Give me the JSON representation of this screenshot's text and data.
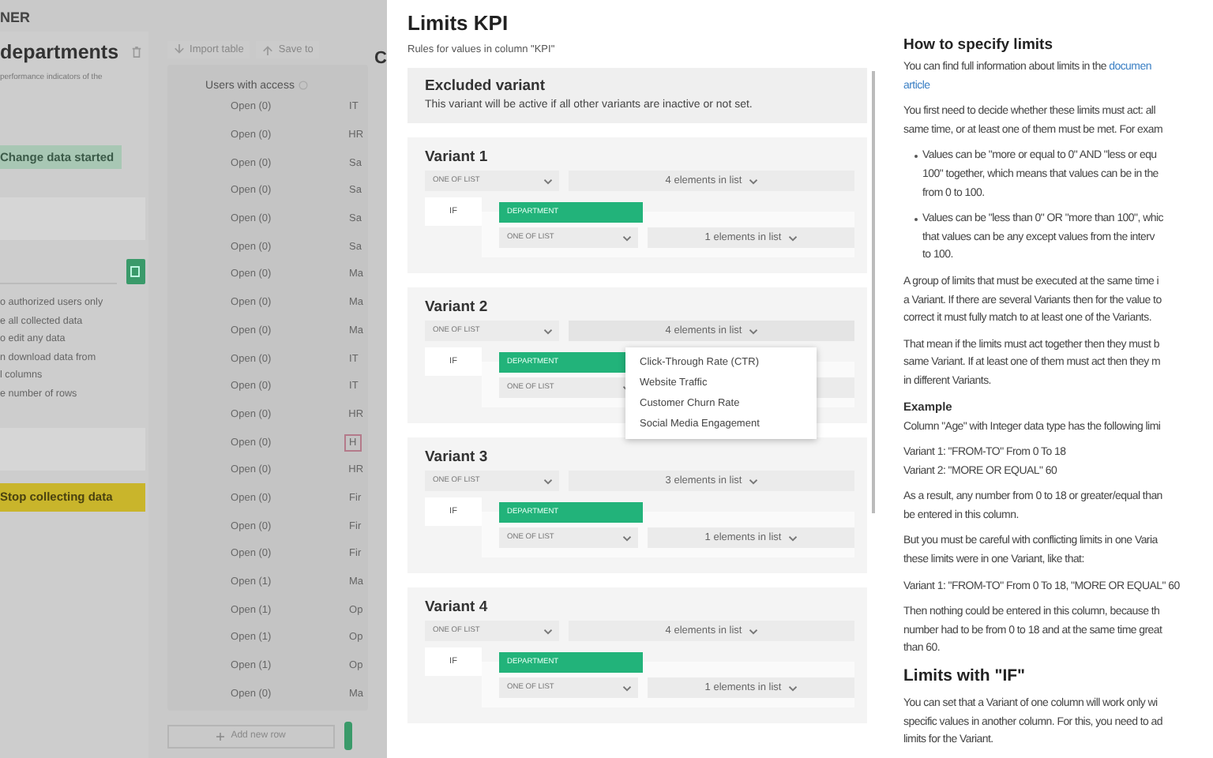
{
  "background_app": {
    "header": "NER",
    "panel": {
      "title": "departments",
      "description": "performance indicators of the",
      "status_badge": "Change data started",
      "options": [
        "o authorized users only",
        "e all collected data",
        "o edit any data",
        "n download data from",
        "l columns",
        "e number of rows"
      ],
      "stop_button": "Stop collecting data"
    },
    "toolbar": [
      "Import table",
      "Save to"
    ],
    "table": {
      "column": "Users with access",
      "rows": [
        {
          "access": "Open (0)",
          "column_2": "IT",
          "highlighted": false
        },
        {
          "access": "Open (0)",
          "column_2": "HR",
          "highlighted": false
        },
        {
          "access": "Open (0)",
          "column_2": "Sa",
          "highlighted": false
        },
        {
          "access": "Open (0)",
          "column_2": "Sa",
          "highlighted": false
        },
        {
          "access": "Open (0)",
          "column_2": "Sa",
          "highlighted": false
        },
        {
          "access": "Open (0)",
          "column_2": "Sa",
          "highlighted": false
        },
        {
          "access": "Open (0)",
          "column_2": "Ma",
          "highlighted": false
        },
        {
          "access": "Open (0)",
          "column_2": "Ma",
          "highlighted": false
        },
        {
          "access": "Open (0)",
          "column_2": "Ma",
          "highlighted": false
        },
        {
          "access": "Open (0)",
          "column_2": "IT",
          "highlighted": false
        },
        {
          "access": "Open (0)",
          "column_2": "IT",
          "highlighted": false
        },
        {
          "access": "Open (0)",
          "column_2": "HR",
          "highlighted": false
        },
        {
          "access": "Open (0)",
          "column_2": "H",
          "highlighted": true
        },
        {
          "access": "Open (0)",
          "column_2": "HR",
          "highlighted": false
        },
        {
          "access": "Open (0)",
          "column_2": "Fir",
          "highlighted": false
        },
        {
          "access": "Open (0)",
          "column_2": "Fir",
          "highlighted": false
        },
        {
          "access": "Open (0)",
          "column_2": "Fir",
          "highlighted": false
        },
        {
          "access": "Open (1)",
          "column_2": "Ma",
          "highlighted": false
        },
        {
          "access": "Open (1)",
          "column_2": "Op",
          "highlighted": false
        },
        {
          "access": "Open (1)",
          "column_2": "Op",
          "highlighted": false
        },
        {
          "access": "Open (1)",
          "column_2": "Op",
          "highlighted": false
        },
        {
          "access": "Open (0)",
          "column_2": "Ma",
          "highlighted": false
        }
      ]
    },
    "add_row_button": "Add new row",
    "next_panel_title": "C"
  },
  "limits": {
    "title": "Limits KPI",
    "subtitle": "Rules for values in column \"KPI\"",
    "excluded": {
      "title": "Excluded variant",
      "text": "This variant will be active if all other variants are inactive or not set."
    },
    "variants": [
      {
        "title": "Variant 1",
        "operator": "ONE OF LIST",
        "values": "4 elements in list",
        "condition": {
          "label": "IF",
          "column": "DEPARTMENT",
          "operator": "ONE OF LIST",
          "values": "1 elements in list"
        }
      },
      {
        "title": "Variant 2",
        "operator": "ONE OF LIST",
        "values": "4 elements in list",
        "options": [
          "Click-Through Rate (CTR)",
          "Website Traffic",
          "Customer Churn Rate",
          "Social Media Engagement"
        ],
        "condition": {
          "label": "IF",
          "column": "DEPARTMENT",
          "operator": "ONE OF LIST"
        }
      },
      {
        "title": "Variant 3",
        "operator": "ONE OF LIST",
        "values": "3 elements in list",
        "condition": {
          "label": "IF",
          "column": "DEPARTMENT",
          "operator": "ONE OF LIST",
          "values": "1 elements in list"
        }
      },
      {
        "title": "Variant 4",
        "operator": "ONE OF LIST",
        "values": "4 elements in list",
        "condition": {
          "label": "IF",
          "column": "DEPARTMENT",
          "operator": "ONE OF LIST",
          "values": "1 elements in list"
        }
      }
    ]
  },
  "help": [
    {
      "kind": "heading",
      "text": "How to specify limits"
    },
    {
      "kind": "paragraph",
      "lines": [
        {
          "text": "You can find full information about limits in the ",
          "link": "documen"
        },
        {
          "link": "article"
        }
      ]
    },
    {
      "kind": "paragraph",
      "lines": [
        {
          "text": "You first need to decide whether these limits must act: all"
        },
        {
          "text": "same time, or at least one of them must be met. For exam"
        }
      ]
    },
    {
      "kind": "bullet",
      "lines": [
        {
          "text": "Values can be \"more or equal to 0\" AND \"less or equ"
        },
        {
          "text": "100\" together, which means that values can be in the"
        },
        {
          "text": "from 0 to 100."
        }
      ]
    },
    {
      "kind": "bullet",
      "lines": [
        {
          "text": "Values can be \"less than 0\" OR \"more than 100\", whic"
        },
        {
          "text": "that values can be any except values from the interv"
        },
        {
          "text": "to 100."
        }
      ]
    },
    {
      "kind": "paragraph",
      "lines": [
        {
          "text": "A group of limits that must be executed at the same time i"
        },
        {
          "text": "a Variant. If there are several Variants then for the value to"
        },
        {
          "text": "correct it must fully match to at least one of the Variants."
        }
      ]
    },
    {
      "kind": "paragraph",
      "lines": [
        {
          "text": "That mean if the limits must act together then they must b"
        },
        {
          "text": "same Variant. If at least one of them must act then they m"
        },
        {
          "text": "in different Variants."
        }
      ]
    },
    {
      "kind": "subheading",
      "text": "Example"
    },
    {
      "kind": "paragraph",
      "lines": [
        {
          "text": "Column \"Age\" with Integer data type has the following limi"
        }
      ]
    },
    {
      "kind": "paragraph",
      "lines": [
        {
          "text": "Variant 1: \"FROM-TO\" From 0 To 18"
        },
        {
          "text": "Variant 2: \"MORE OR EQUAL\" 60"
        }
      ]
    },
    {
      "kind": "paragraph",
      "lines": [
        {
          "text": "As a result, any number from 0 to 18 or greater/equal than"
        },
        {
          "text": "be entered in this column."
        }
      ]
    },
    {
      "kind": "paragraph",
      "lines": [
        {
          "text": "But you must be careful with conflicting limits in one Varia"
        },
        {
          "text": "these limits were in one Variant, like that:"
        }
      ]
    },
    {
      "kind": "paragraph",
      "lines": [
        {
          "text": "Variant 1: \"FROM-TO\" From 0 To 18, \"MORE OR EQUAL\" 60"
        }
      ]
    },
    {
      "kind": "paragraph",
      "lines": [
        {
          "text": "Then nothing could be entered in this column, because th"
        },
        {
          "text": "number had to be from 0 to 18 and at the same time great"
        },
        {
          "text": "than 60."
        }
      ]
    },
    {
      "kind": "heading2",
      "text": "Limits with \"IF\""
    },
    {
      "kind": "paragraph",
      "lines": [
        {
          "text": "You can set that a Variant of one column will work only wi"
        },
        {
          "text": "specific values in another column. For this, you need to ad"
        },
        {
          "text": "limits for the Variant."
        }
      ]
    }
  ]
}
